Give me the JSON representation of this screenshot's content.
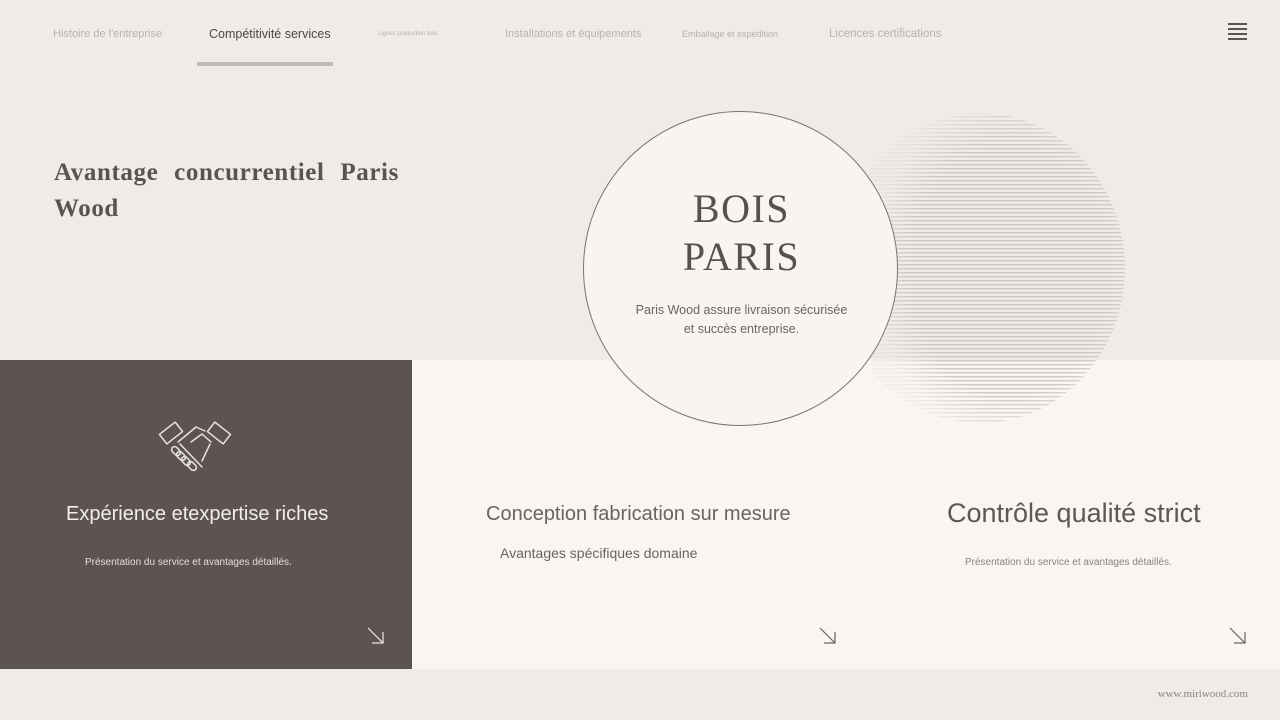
{
  "nav": {
    "items": [
      {
        "label": "Histoire de l'entreprise"
      },
      {
        "label": "Compétitivité services"
      },
      {
        "label": "Lignes production bois"
      },
      {
        "label": "Installations et équipements"
      },
      {
        "label": "Emballage et expédition"
      },
      {
        "label": "Licences certifications"
      }
    ],
    "active_index": 1,
    "menu_icon": "hamburger-menu-icon"
  },
  "hero": {
    "title": "Avantage concurrentiel Paris Wood"
  },
  "brand_circle": {
    "title_line1": "BOIS",
    "title_line2": "PARIS",
    "text_line1": "Paris Wood assure livraison sécurisée",
    "text_line2": "et succès entreprise."
  },
  "cards": [
    {
      "icon": "handshake-icon",
      "title": "Expérience etexpertise riches",
      "description": "Présentation du service et avantages détaillés."
    },
    {
      "title": "Conception fabrication sur mesure",
      "description": "Avantages spécifiques domaine"
    },
    {
      "title": "Contrôle qualité strict",
      "description": "Présentation du service et avantages détaillés."
    }
  ],
  "footer": {
    "url": "www.miriwood.com"
  },
  "colors": {
    "background": "#efebe8",
    "dark_panel": "#5d5451",
    "light_panel": "#f8f5f3",
    "text": "#5d5552"
  }
}
